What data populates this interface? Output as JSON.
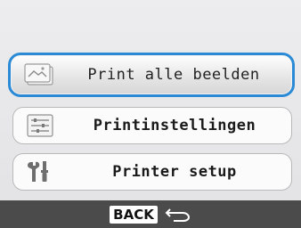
{
  "menu": {
    "items": [
      {
        "label": "Print alle beelden",
        "icon": "print-all-images-icon",
        "selected": true
      },
      {
        "label": "Printinstellingen",
        "icon": "print-settings-icon",
        "selected": false
      },
      {
        "label": "Printer setup",
        "icon": "printer-setup-tools-icon",
        "selected": false
      }
    ]
  },
  "footer": {
    "back_label": "BACK",
    "back_icon": "return-arrow-icon"
  },
  "colors": {
    "selection_border": "#2a8ad6",
    "bottom_bar": "#4b4b4b"
  }
}
